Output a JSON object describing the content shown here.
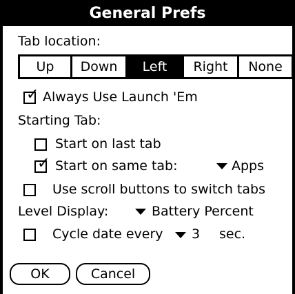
{
  "title": "General Prefs",
  "tab_location": {
    "label": "Tab location:",
    "options": [
      "Up",
      "Down",
      "Left",
      "Right",
      "None"
    ],
    "selected": "Left"
  },
  "always_use": {
    "label": "Always Use Launch 'Em",
    "checked": true
  },
  "starting_tab": {
    "label": "Starting Tab:",
    "start_last": {
      "label": "Start on last tab",
      "checked": false
    },
    "start_same": {
      "label": "Start on same tab:",
      "checked": true,
      "value": "Apps"
    }
  },
  "scroll_buttons": {
    "label": "Use scroll buttons to switch tabs",
    "checked": false
  },
  "level_display": {
    "label": "Level Display:",
    "value": "Battery Percent"
  },
  "cycle_date": {
    "label": "Cycle date every",
    "checked": false,
    "value": "3",
    "unit": "sec."
  },
  "buttons": {
    "ok": "OK",
    "cancel": "Cancel"
  }
}
